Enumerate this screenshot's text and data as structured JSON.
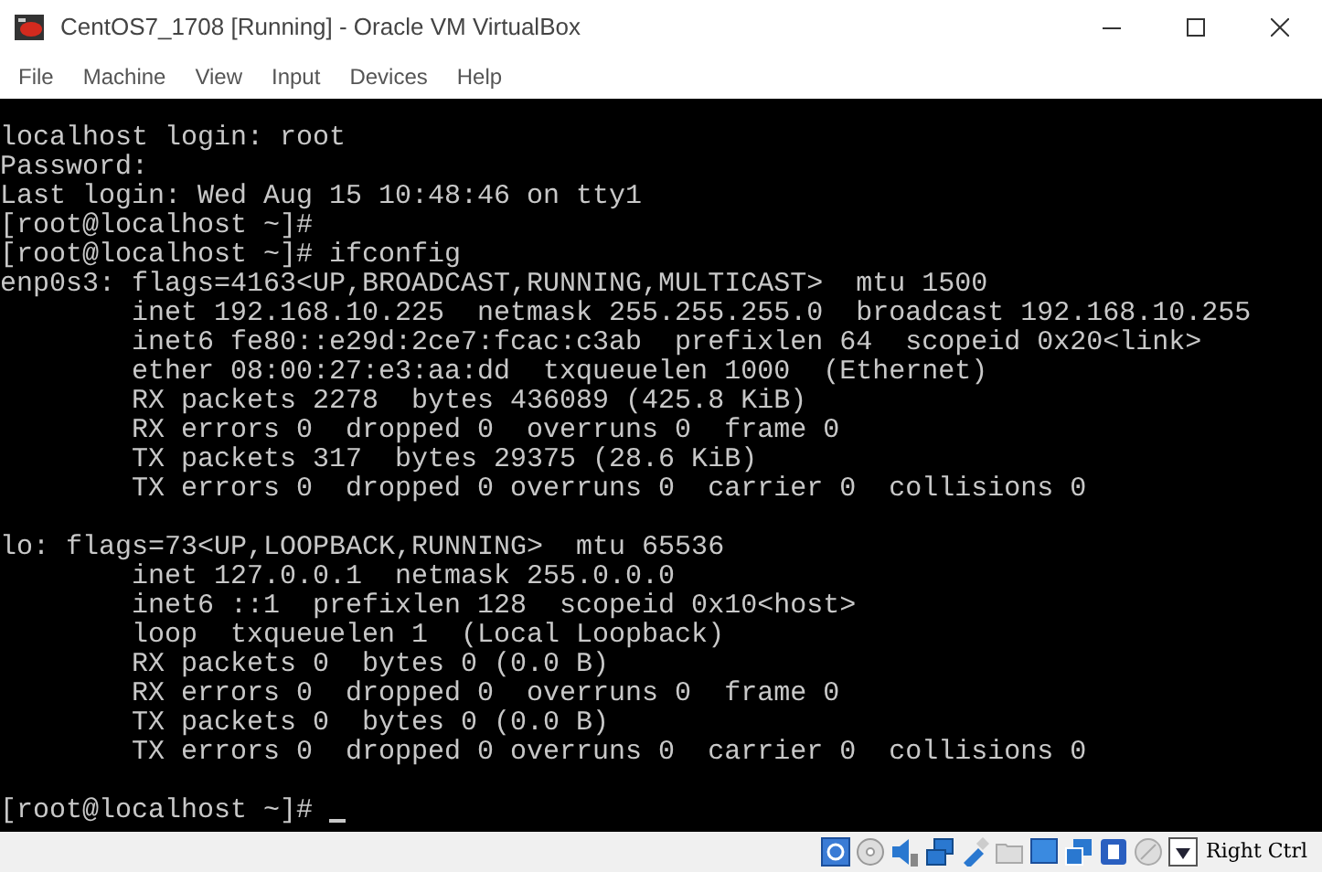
{
  "window": {
    "title": "CentOS7_1708 [Running] - Oracle VM VirtualBox"
  },
  "menu": [
    "File",
    "Machine",
    "View",
    "Input",
    "Devices",
    "Help"
  ],
  "terminal": {
    "blocks": [
      [
        "localhost login: root",
        "Password:",
        "Last login: Wed Aug 15 10:48:46 on tty1",
        "[root@localhost ~]#",
        "[root@localhost ~]# ifconfig",
        "enp0s3: flags=4163<UP,BROADCAST,RUNNING,MULTICAST>  mtu 1500",
        "        inet 192.168.10.225  netmask 255.255.255.0  broadcast 192.168.10.255",
        "        inet6 fe80::e29d:2ce7:fcac:c3ab  prefixlen 64  scopeid 0x20<link>",
        "        ether 08:00:27:e3:aa:dd  txqueuelen 1000  (Ethernet)",
        "        RX packets 2278  bytes 436089 (425.8 KiB)",
        "        RX errors 0  dropped 0  overruns 0  frame 0",
        "        TX packets 317  bytes 29375 (28.6 KiB)",
        "        TX errors 0  dropped 0 overruns 0  carrier 0  collisions 0"
      ],
      [
        "lo: flags=73<UP,LOOPBACK,RUNNING>  mtu 65536",
        "        inet 127.0.0.1  netmask 255.0.0.0",
        "        inet6 ::1  prefixlen 128  scopeid 0x10<host>",
        "        loop  txqueuelen 1  (Local Loopback)",
        "        RX packets 0  bytes 0 (0.0 B)",
        "        RX errors 0  dropped 0  overruns 0  frame 0",
        "        TX packets 0  bytes 0 (0.0 B)",
        "        TX errors 0  dropped 0 overruns 0  carrier 0  collisions 0"
      ],
      [
        "[root@localhost ~]# "
      ]
    ],
    "cursor": true
  },
  "status_bar": {
    "host_key": "Right Ctrl"
  }
}
